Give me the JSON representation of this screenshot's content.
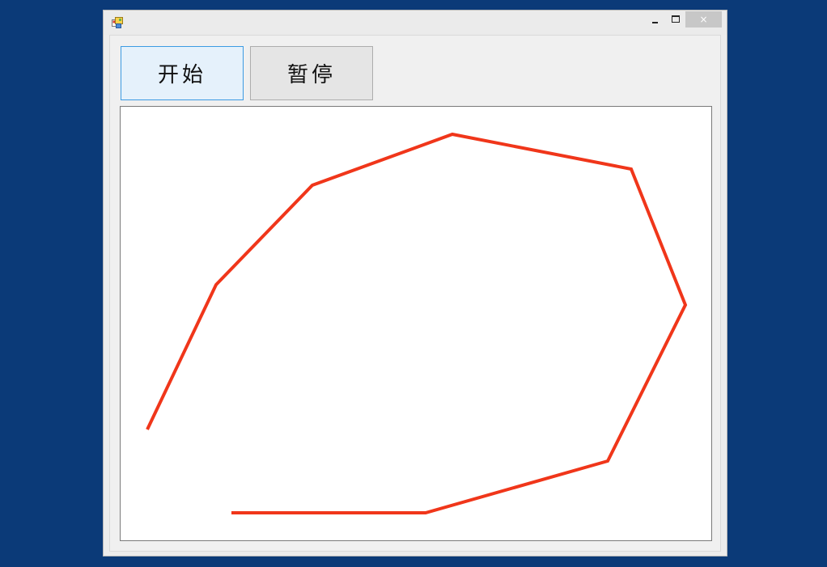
{
  "window": {
    "title": "",
    "icon": "winforms-app-icon",
    "controls": {
      "minimize": "minimize-icon",
      "maximize": "maximize-icon",
      "close": "×"
    }
  },
  "toolbar": {
    "start_label": "开始",
    "pause_label": "暂停"
  },
  "drawing": {
    "stroke_color": "#f0361a",
    "background_color": "#ffffff"
  },
  "colors": {
    "desktop": "#0b3a78",
    "start_button_border": "#3c9be3"
  }
}
